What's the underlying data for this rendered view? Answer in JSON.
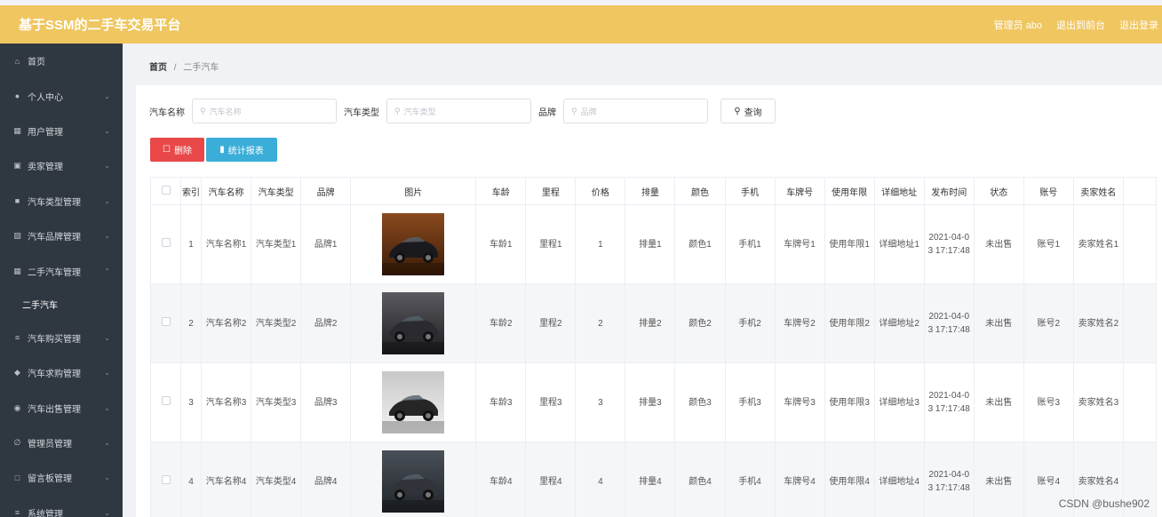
{
  "header": {
    "title": "基于SSM的二手车交易平台",
    "admin": "管理员 abo",
    "exit_front": "退出到前台",
    "logout": "退出登录"
  },
  "sidebar": {
    "items": [
      {
        "icon": "home-icon",
        "label": "首页",
        "chevron": false
      },
      {
        "icon": "user-icon",
        "label": "个人中心",
        "chevron": true
      },
      {
        "icon": "users-icon",
        "label": "用户管理",
        "chevron": true
      },
      {
        "icon": "seller-icon",
        "label": "卖家管理",
        "chevron": true
      },
      {
        "icon": "category-icon",
        "label": "汽车类型管理",
        "chevron": true
      },
      {
        "icon": "brand-icon",
        "label": "汽车品牌管理",
        "chevron": true
      },
      {
        "icon": "grid-icon",
        "label": "二手汽车管理",
        "chevron": true,
        "expanded": true
      },
      {
        "icon": "cart-icon",
        "label": "汽车购买管理",
        "chevron": true
      },
      {
        "icon": "location-icon",
        "label": "汽车求购管理",
        "chevron": true
      },
      {
        "icon": "globe-icon",
        "label": "汽车出售管理",
        "chevron": true
      },
      {
        "icon": "admin-icon",
        "label": "管理员管理",
        "chevron": true
      },
      {
        "icon": "message-icon",
        "label": "留言板管理",
        "chevron": true
      },
      {
        "icon": "system-icon",
        "label": "系统管理",
        "chevron": true
      }
    ],
    "sub_item": "二手汽车"
  },
  "breadcrumb": {
    "home": "首页",
    "sep": "/",
    "current": "二手汽车"
  },
  "search": {
    "name_label": "汽车名称",
    "name_placeholder": "汽车名称",
    "type_label": "汽车类型",
    "type_placeholder": "汽车类型",
    "brand_label": "品牌",
    "brand_placeholder": "品牌",
    "query_label": "查询"
  },
  "actions": {
    "delete_label": "删除",
    "stats_label": "统计报表"
  },
  "table": {
    "headers": [
      "",
      "索引",
      "汽车名称",
      "汽车类型",
      "品牌",
      "图片",
      "车龄",
      "里程",
      "价格",
      "排量",
      "颜色",
      "手机",
      "车牌号",
      "使用年限",
      "详细地址",
      "发布时间",
      "状态",
      "账号",
      "卖家姓名",
      ""
    ],
    "rows": [
      {
        "index": "1",
        "name": "汽车名称1",
        "type": "汽车类型1",
        "brand": "品牌1",
        "age": "车龄1",
        "mileage": "里程1",
        "price": "1",
        "displacement": "排量1",
        "color": "颜色1",
        "phone": "手机1",
        "plate": "车牌号1",
        "years": "使用年限1",
        "address": "详细地址1",
        "time": "2021-04-03 17:17:48",
        "status": "未出售",
        "account": "账号1",
        "seller": "卖家姓名1"
      },
      {
        "index": "2",
        "name": "汽车名称2",
        "type": "汽车类型2",
        "brand": "品牌2",
        "age": "车龄2",
        "mileage": "里程2",
        "price": "2",
        "displacement": "排量2",
        "color": "颜色2",
        "phone": "手机2",
        "plate": "车牌号2",
        "years": "使用年限2",
        "address": "详细地址2",
        "time": "2021-04-03 17:17:48",
        "status": "未出售",
        "account": "账号2",
        "seller": "卖家姓名2"
      },
      {
        "index": "3",
        "name": "汽车名称3",
        "type": "汽车类型3",
        "brand": "品牌3",
        "age": "车龄3",
        "mileage": "里程3",
        "price": "3",
        "displacement": "排量3",
        "color": "颜色3",
        "phone": "手机3",
        "plate": "车牌号3",
        "years": "使用年限3",
        "address": "详细地址3",
        "time": "2021-04-03 17:17:48",
        "status": "未出售",
        "account": "账号3",
        "seller": "卖家姓名3"
      },
      {
        "index": "4",
        "name": "汽车名称4",
        "type": "汽车类型4",
        "brand": "品牌4",
        "age": "车龄4",
        "mileage": "里程4",
        "price": "4",
        "displacement": "排量4",
        "color": "颜色4",
        "phone": "手机4",
        "plate": "车牌号4",
        "years": "使用年限4",
        "address": "详细地址4",
        "time": "2021-04-03 17:17:48",
        "status": "未出售",
        "account": "账号4",
        "seller": "卖家姓名4"
      }
    ]
  },
  "watermark": "CSDN @bushe902",
  "colors": {
    "header": "#efc65f",
    "sidebar": "#2f3741",
    "delete": "#e84848",
    "stats": "#3aaed8"
  }
}
